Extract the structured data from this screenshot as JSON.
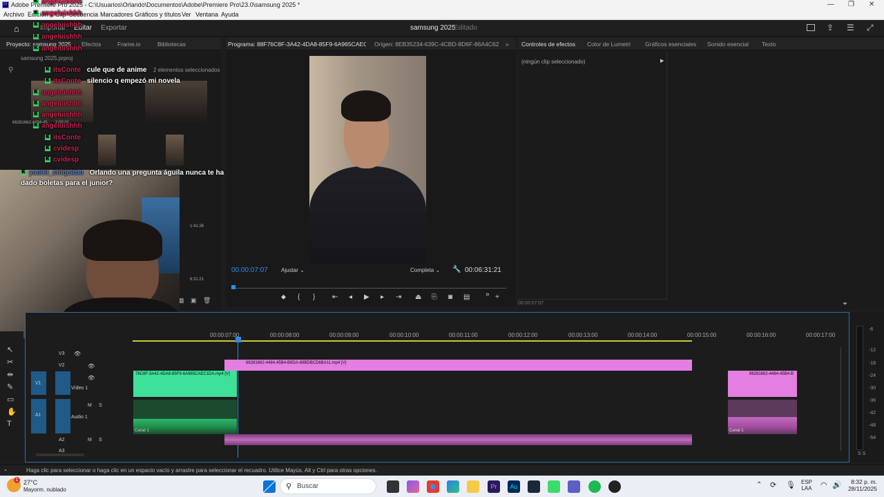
{
  "window": {
    "title": "Adobe Premiere Pro 2025 - C:\\Usuarios\\Orlando\\Documentos\\Adobe\\Premiere Pro\\23.0\\samsung 2025 *",
    "minimize": "—",
    "maximize": "❐",
    "close": "✕"
  },
  "menu": [
    "Archivo",
    "Edición",
    "Clip",
    "Secuencia",
    "Marcadores",
    "Gráficos y títulos",
    "Ver",
    "Ventana",
    "Ayuda"
  ],
  "header": {
    "tabs": [
      "Importar",
      "Editar",
      "Exportar"
    ],
    "active_tab": "Editar",
    "project_title": "samsung 2025",
    "project_state": "Editado"
  },
  "project_panel": {
    "tabs": [
      "Proyecto: samsung 2025",
      "Efectos",
      "Frame.io",
      "Bibliotecas"
    ],
    "file": "samsung 2025.prproj",
    "selection": "2 elementos seleccionados",
    "items": [
      {
        "name": "66281662-4484-45...",
        "duration": "2:00:01"
      },
      {
        "name": "",
        "duration": "1:41:26"
      },
      {
        "name": "",
        "duration": "6:31:21"
      }
    ]
  },
  "chat": [
    {
      "user": "angeluishhh",
      "msg": ""
    },
    {
      "user": "angeluishhh",
      "msg": ""
    },
    {
      "user": "angeluishhh",
      "msg": ""
    },
    {
      "user": "angeluishhh",
      "msg": ""
    },
    {
      "user": "angeluishhh",
      "msg": ""
    },
    {
      "user": "itsConte",
      "msg": "cule que de anime"
    },
    {
      "user": "itsConte",
      "msg": "silencio q empezó mi novela"
    },
    {
      "user": "angeluishhh",
      "msg": ""
    },
    {
      "user": "angeluishhh",
      "msg": ""
    },
    {
      "user": "angeluishhh",
      "msg": ""
    },
    {
      "user": "angeluishhh",
      "msg": ""
    },
    {
      "user": "itsConte",
      "msg": ""
    },
    {
      "user": "cvidesp",
      "msg": ""
    },
    {
      "user": "cvidesp",
      "msg": ""
    },
    {
      "user": "yadiel_chiquitoo",
      "msg": "Orlando una pregunta águila nunca te ha dado boletas para el junior?"
    }
  ],
  "program_monitor": {
    "tabs": [
      "Programa: 88F76C8F-3A42-4DA8-85F9-6A965CAEC1DA",
      "Origen: 8EB35234-639C-4CBD-8D6F-86A4C621AE1A"
    ],
    "timecode": "00:00:07:07",
    "fit": "Ajustar",
    "quality": "Completa",
    "duration": "00:06:31:21"
  },
  "effects_panel": {
    "tabs": [
      "Controles de efectos",
      "Color de Lumetri",
      "Gráficos esenciales",
      "Sonido esencial",
      "Texto"
    ],
    "no_clip": "(ningún clip seleccionado)",
    "timecode": "00:00:07:07"
  },
  "timeline": {
    "ruler": [
      "00:00:07:00",
      "00:00:08:00",
      "00:00:09:00",
      "00:00:10:00",
      "00:00:11:00",
      "00:00:12:00",
      "00:00:13:00",
      "00:00:14:00",
      "00:00:15:00",
      "00:00:16:00",
      "00:00:17:00"
    ],
    "tracks": [
      {
        "id": "V3",
        "name": ""
      },
      {
        "id": "V2",
        "name": ""
      },
      {
        "id": "V1",
        "name": "Vídeo 1"
      },
      {
        "id": "A1",
        "name": "Audio 1"
      },
      {
        "id": "A2",
        "name": ""
      },
      {
        "id": "A3",
        "name": ""
      }
    ],
    "clips": {
      "v2_clip": "66281662-4484-45B4-B9DA-69BDBCD6BA11.mp4 [V]",
      "v1_clip": "76C8F-3A42-4DA8-85F9-6A965CAEC1DA.mp4 [V]",
      "v1_right_clip": "66281662-4484-45B4-B",
      "a1_label": "Canal 1",
      "a1_right_label": "Canal 1"
    },
    "meter_scale": [
      "-6",
      "-12",
      "-18",
      "-24",
      "-30",
      "-36",
      "-42",
      "-48",
      "-54"
    ],
    "meter_bottom": "S S"
  },
  "status": "Haga clic para seleccionar o haga clic en un espacio vacío y arrastre para seleccionar el recuadro. Utilice Mayús, Alt y Ctrl para otras opciones.",
  "taskbar": {
    "weather_temp": "27°C",
    "weather_desc": "Mayorm. nublado",
    "weather_badge": "1",
    "search": "Buscar",
    "lang": "ESP",
    "region": "LAA",
    "time": "8:32 p. m.",
    "date": "28/11/2025",
    "apps": [
      "Premiere Pro",
      "Audition"
    ],
    "colors": {
      "premiere": "#2b1a5e",
      "audition": "#00265e",
      "spotify": "#1db954",
      "chrome": "#e33b2e",
      "files": "#f7c948",
      "windows": "#0a74da",
      "steam": "#1b2838"
    }
  },
  "colors": {
    "accent": "#2d8ceb",
    "video_clip_green": "#3fe09a",
    "clip_pink": "#e37fe0",
    "audio_green": "#1e8a4a",
    "audio_pink": "#a34a9f",
    "chat_user": "#c4224e"
  }
}
